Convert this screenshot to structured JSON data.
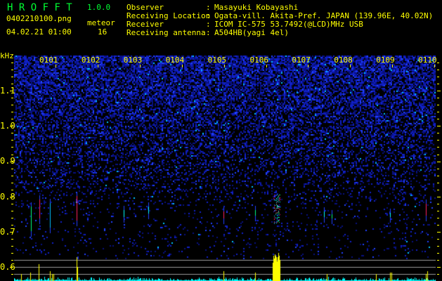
{
  "app": {
    "name": "H R O F F T",
    "version": "1.0.0"
  },
  "file": {
    "name": "0402210100.png",
    "datetime": "04.02.21 01:00"
  },
  "meteor": {
    "label": "meteor",
    "count": "16"
  },
  "info": [
    {
      "label": "Observer",
      "sep": ":",
      "value": "Masayuki Kobayashi"
    },
    {
      "label": "Receiving Location",
      "sep": ":",
      "value": "Ogata-vill. Akita-Pref. JAPAN (139.96E, 40.02N)"
    },
    {
      "label": "Receiver",
      "sep": ":",
      "value": "ICOM IC-575 53.7492(@LCD)MHz USB"
    },
    {
      "label": "Receiving antenna",
      "sep": ":",
      "value": "A504HB(yagi 4el)"
    }
  ],
  "axis": {
    "unit": "kHz",
    "freq_labels": [
      "1.1",
      "1.0",
      "0.9",
      "0.8",
      "0.7",
      "0.6"
    ],
    "time_labels": [
      "0101",
      "0102",
      "0103",
      "0104",
      "0105",
      "0106",
      "0107",
      "0108",
      "0109",
      "0110"
    ]
  },
  "colors": {
    "text": "#ffff00",
    "title": "#00ff33",
    "noise": "#1a2cff",
    "counts": "#00ffff",
    "grid": "#9a9a9a"
  }
}
